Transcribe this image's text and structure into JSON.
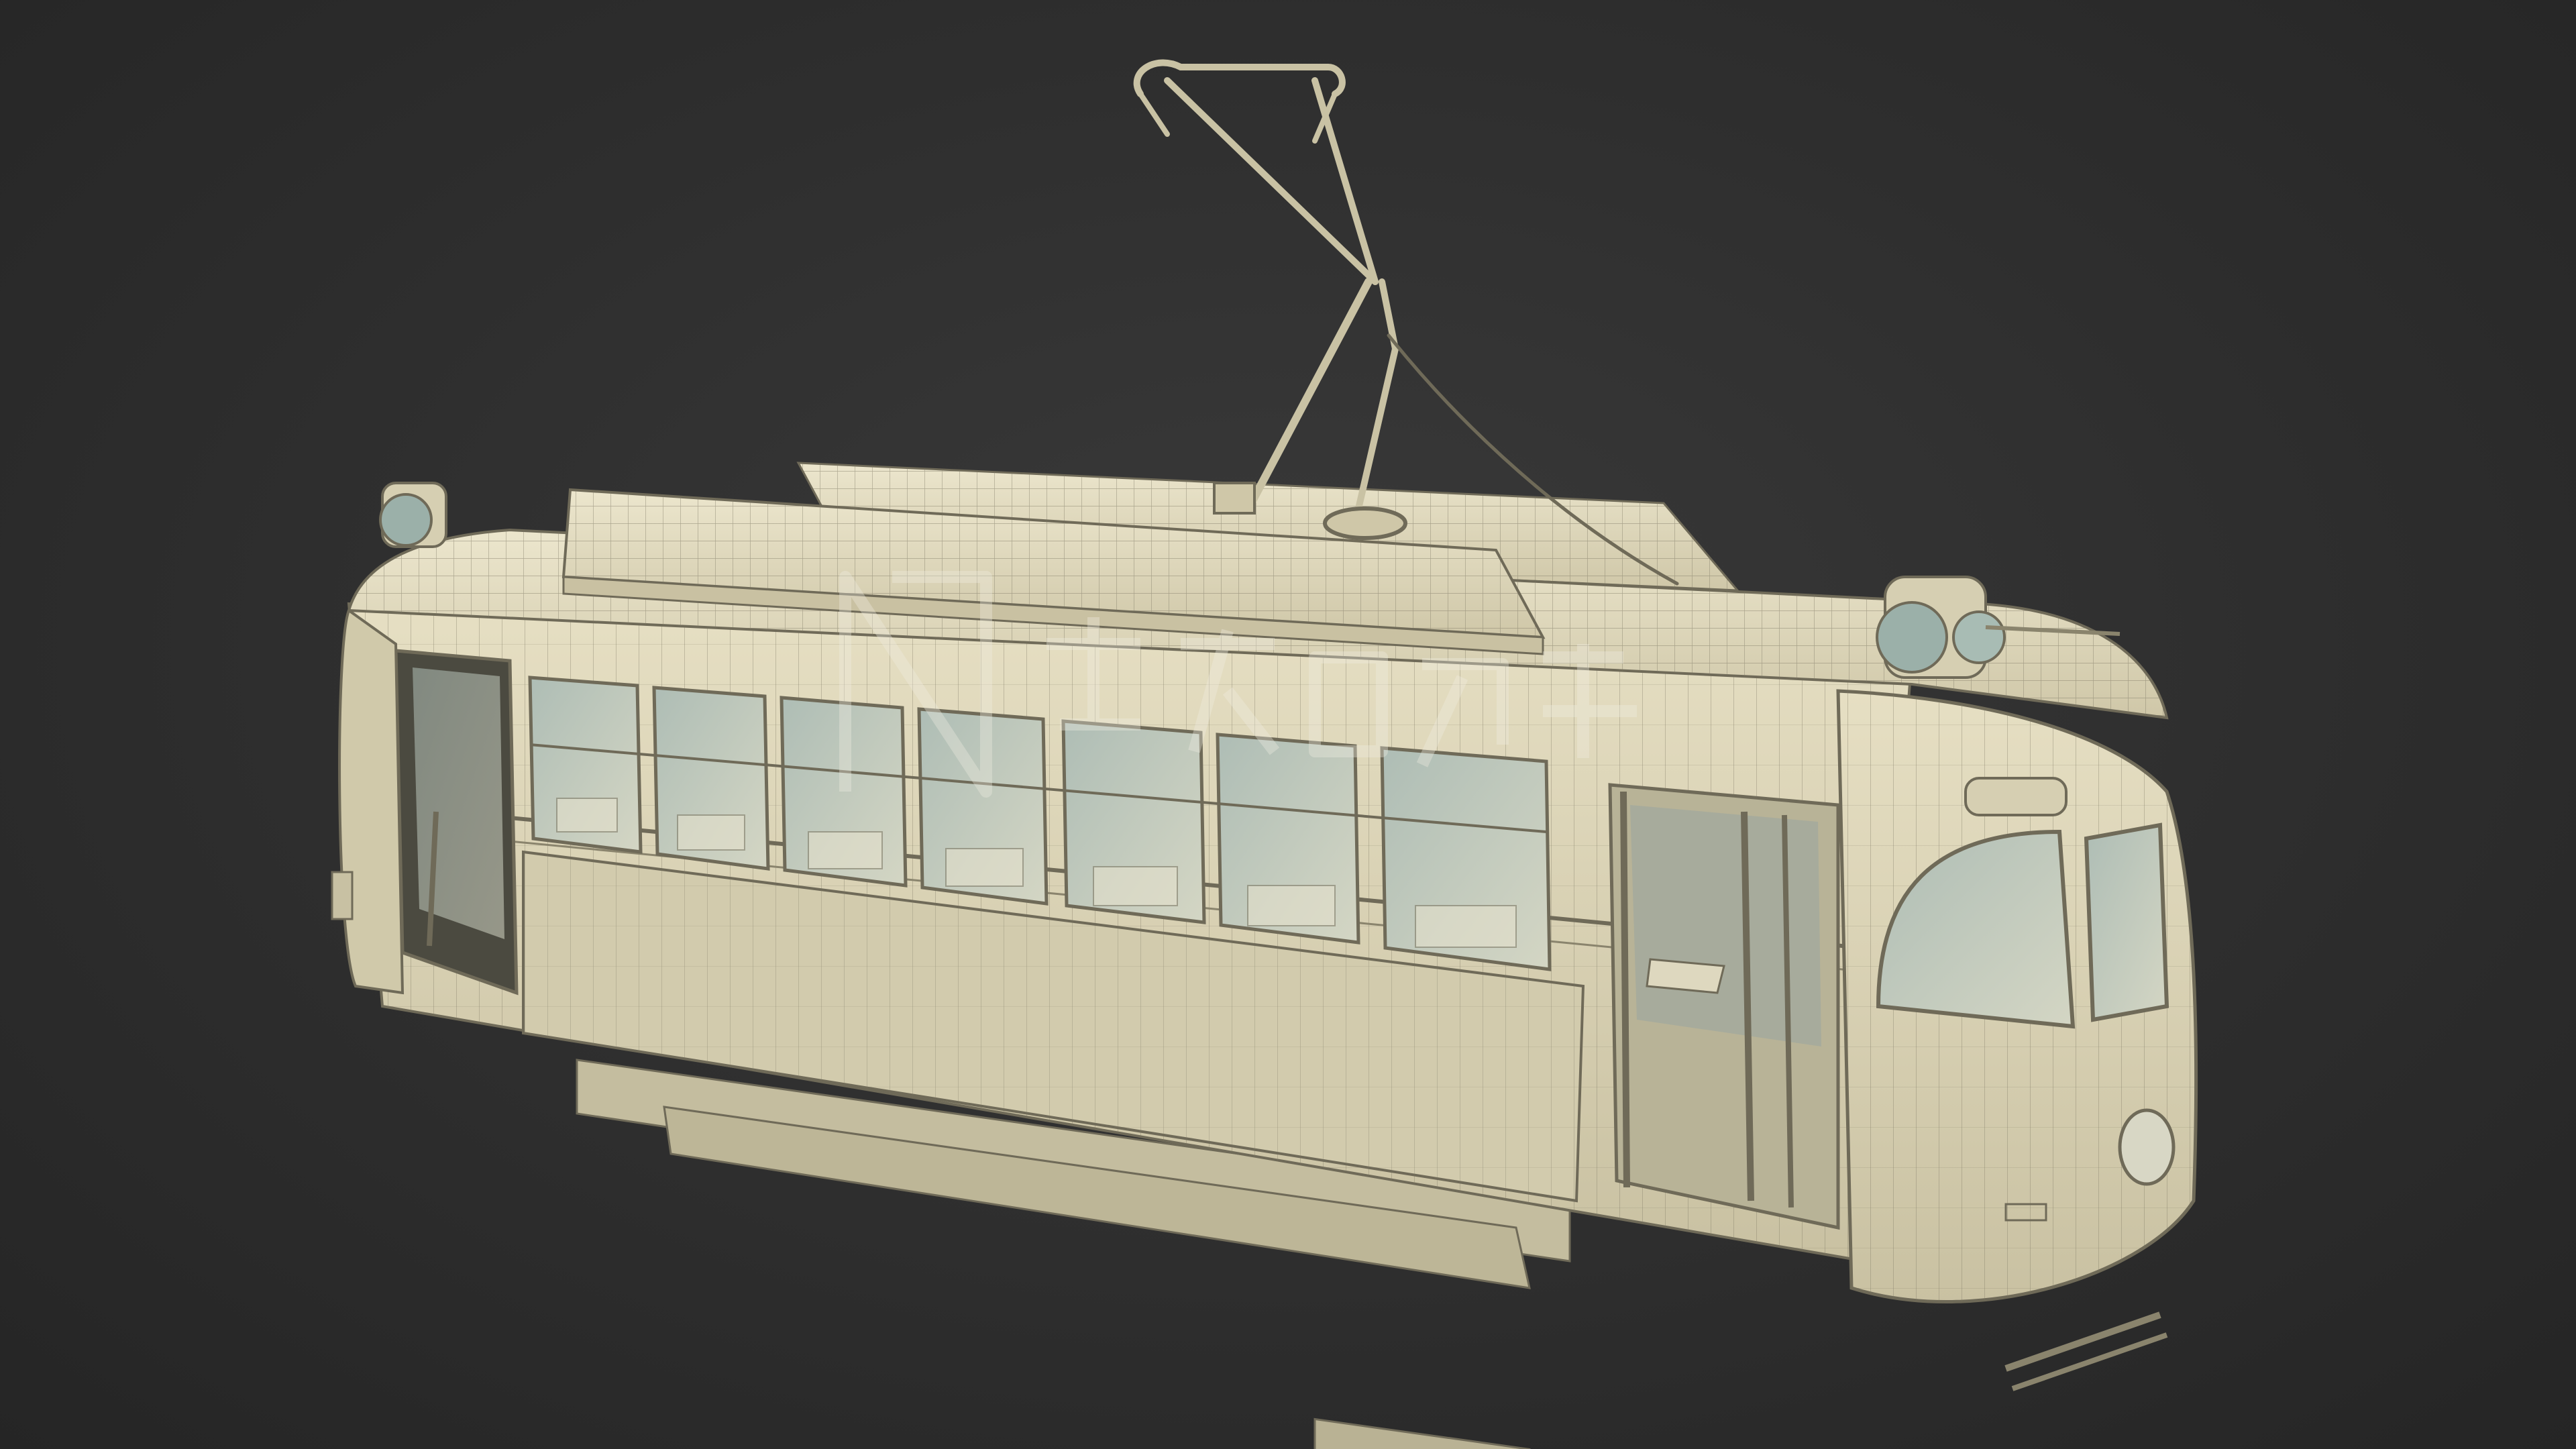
{
  "scene": {
    "background_color": "#2f2f2f",
    "model_color": "#d9d2b4",
    "wire_color": "#6f6a58",
    "glass_color": "#9fb3ad",
    "subject": "tram-wireframe-render"
  },
  "watermark": {
    "kind": "logo-watermark",
    "text": "N 先知 ..."
  }
}
